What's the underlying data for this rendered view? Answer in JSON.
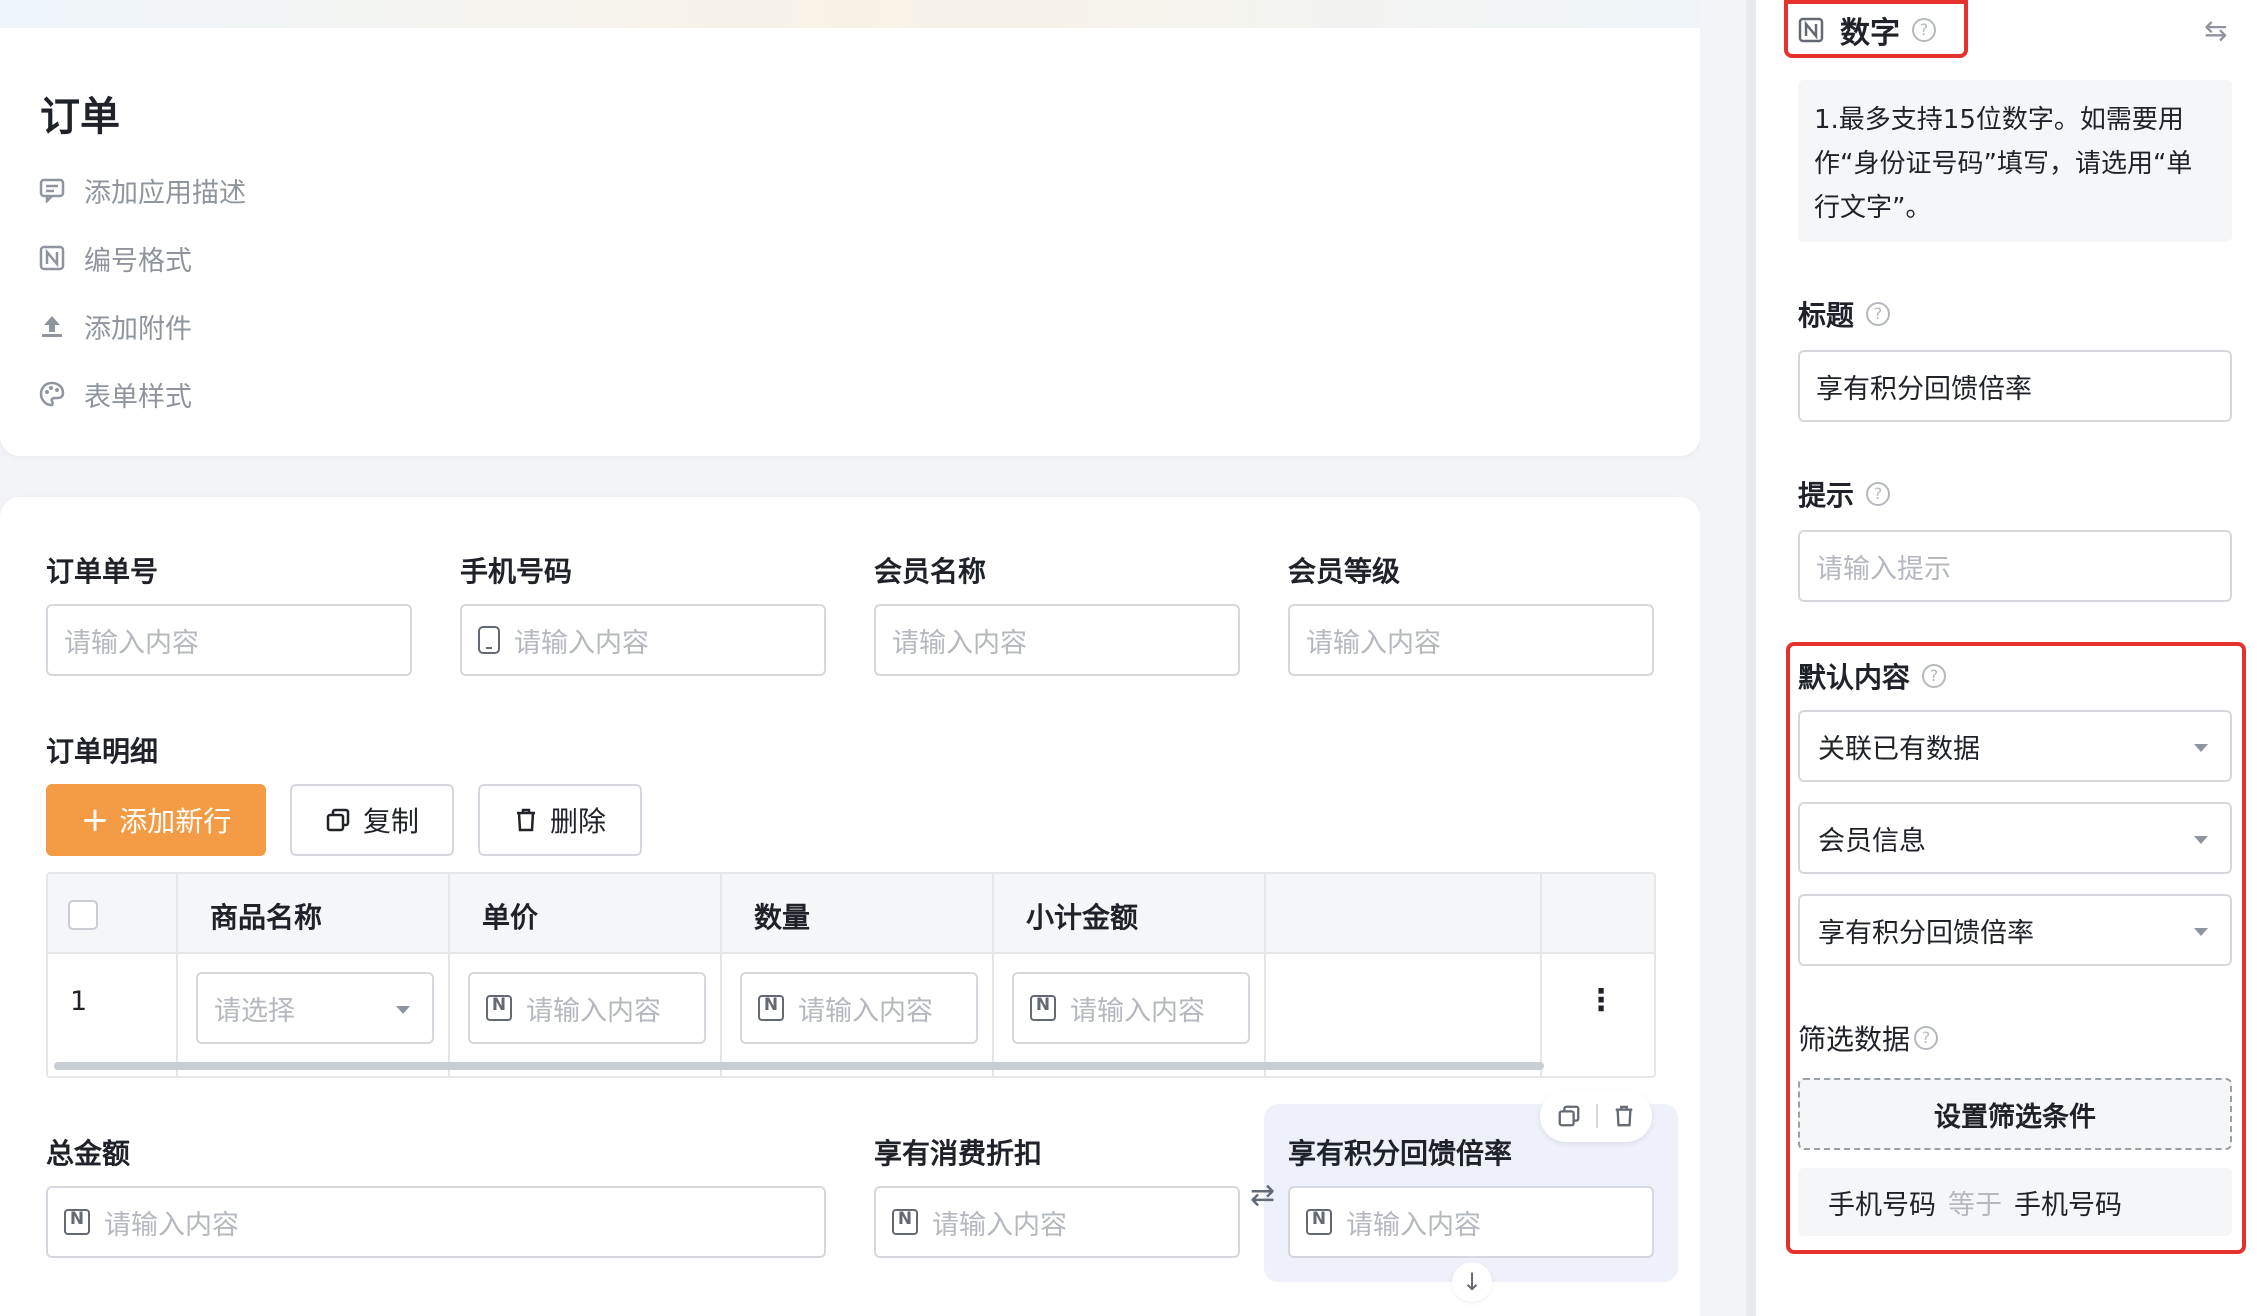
{
  "header": {
    "title": "订单",
    "meta_items": [
      {
        "label": "添加应用描述",
        "icon": "comment-icon"
      },
      {
        "label": "编号格式",
        "icon": "number-icon"
      },
      {
        "label": "添加附件",
        "icon": "upload-icon"
      },
      {
        "label": "表单样式",
        "icon": "palette-icon"
      }
    ]
  },
  "form": {
    "top_fields": [
      {
        "label": "订单单号",
        "placeholder": "请输入内容"
      },
      {
        "label": "手机号码",
        "placeholder": "请输入内容"
      },
      {
        "label": "会员名称",
        "placeholder": "请输入内容"
      },
      {
        "label": "会员等级",
        "placeholder": "请输入内容"
      }
    ],
    "detail": {
      "label": "订单明细",
      "add_button": "添加新行",
      "copy_button": "复制",
      "delete_button": "删除",
      "columns": [
        "商品名称",
        "单价",
        "数量",
        "小计金额"
      ],
      "row": {
        "index": "1",
        "product_placeholder": "请选择",
        "price_placeholder": "请输入内容",
        "qty_placeholder": "请输入内容",
        "subtotal_placeholder": "请输入内容"
      }
    },
    "bottom_fields": [
      {
        "label": "总金额",
        "placeholder": "请输入内容"
      },
      {
        "label": "享有消费折扣",
        "placeholder": "请输入内容"
      },
      {
        "label": "享有积分回馈倍率",
        "placeholder": "请输入内容"
      }
    ]
  },
  "panel": {
    "field_type": "数字",
    "tip": "1.最多支持15位数字。如需要用作“身份证号码”填写，请选用“单行文字”。",
    "title_label": "标题",
    "title_value": "享有积分回馈倍率",
    "hint_label": "提示",
    "hint_placeholder": "请输入提示",
    "default_label": "默认内容",
    "default_mode": "关联已有数据",
    "default_form": "会员信息",
    "default_field": "享有积分回馈倍率",
    "filter_label": "筛选数据",
    "filter_button": "设置筛选条件",
    "filter_condition": {
      "left": "手机号码",
      "op": "等于",
      "right": "手机号码"
    }
  },
  "colors": {
    "primary": "#f39c45",
    "highlight": "#e5322d"
  }
}
